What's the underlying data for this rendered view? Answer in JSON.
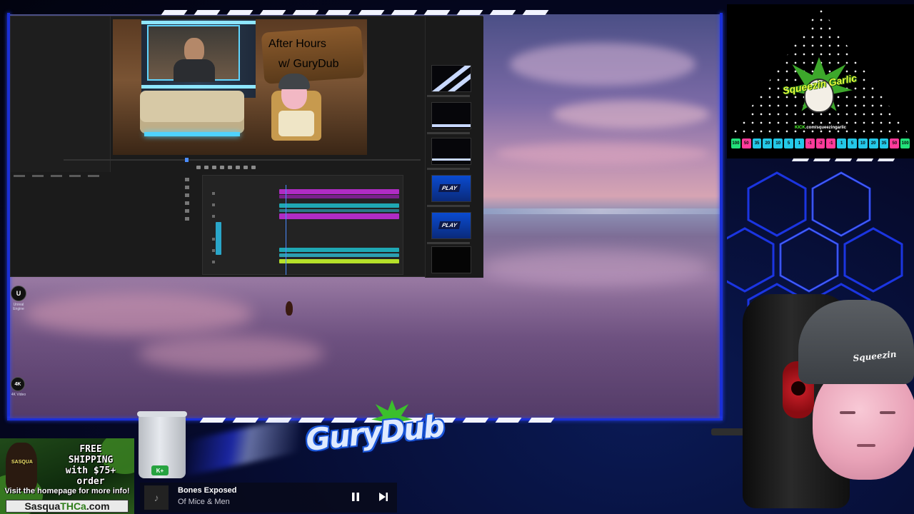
{
  "editor": {
    "preview_sign_title": "After Hours",
    "preview_sign_sub": "w/ GuryDub",
    "play_label": "PLAY"
  },
  "desktop_icons": [
    {
      "glyph": "U",
      "label": "Unreal Engine",
      "icon": "unreal-engine-icon"
    },
    {
      "glyph": "4K",
      "label": "4K Video",
      "icon": "4k-video-icon"
    }
  ],
  "sponsor": {
    "headline": "FREE\nSHIPPING\nwith $75+\norder",
    "subline": "Visit the homepage for more info!",
    "url_prefix": "Sasqua",
    "url_mid": "THCa",
    "url_suffix": ".com",
    "logo_text": "SASQUA"
  },
  "garlic_logo": {
    "title": "Squeezin Garlic",
    "kick_prefix": "KICK",
    "kick_path": ".com/squeezingarlic"
  },
  "point_chips": [
    {
      "text": "100",
      "color": "#22e07a"
    },
    {
      "text": "50",
      "color": "#ff3b9a"
    },
    {
      "text": "35",
      "color": "#24c8e8"
    },
    {
      "text": "20",
      "color": "#24c8e8"
    },
    {
      "text": "10",
      "color": "#24c8e8"
    },
    {
      "text": "5",
      "color": "#24c8e8"
    },
    {
      "text": "1",
      "color": "#24c8e8"
    },
    {
      "text": "-1",
      "color": "#ff3b9a"
    },
    {
      "text": "-2",
      "color": "#ff3b9a"
    },
    {
      "text": "-1",
      "color": "#ff3b9a"
    },
    {
      "text": "1",
      "color": "#24c8e8"
    },
    {
      "text": "5",
      "color": "#24c8e8"
    },
    {
      "text": "10",
      "color": "#24c8e8"
    },
    {
      "text": "20",
      "color": "#24c8e8"
    },
    {
      "text": "35",
      "color": "#24c8e8"
    },
    {
      "text": "50",
      "color": "#ff3b9a"
    },
    {
      "text": "100",
      "color": "#22e07a"
    }
  ],
  "jar_badge": "K+",
  "brand_logo": "GuryDub",
  "beanie_text": "Squeezin",
  "now_playing": {
    "title": "Bones Exposed",
    "artist": "Of Mice & Men",
    "pause_icon": "pause-icon",
    "next_icon": "skip-next-icon"
  },
  "colors": {
    "accent_blue": "#1a2fd8",
    "clip_magenta": "#b02cc4",
    "clip_teal": "#1fa8b4",
    "clip_lime": "#b6e02a"
  }
}
